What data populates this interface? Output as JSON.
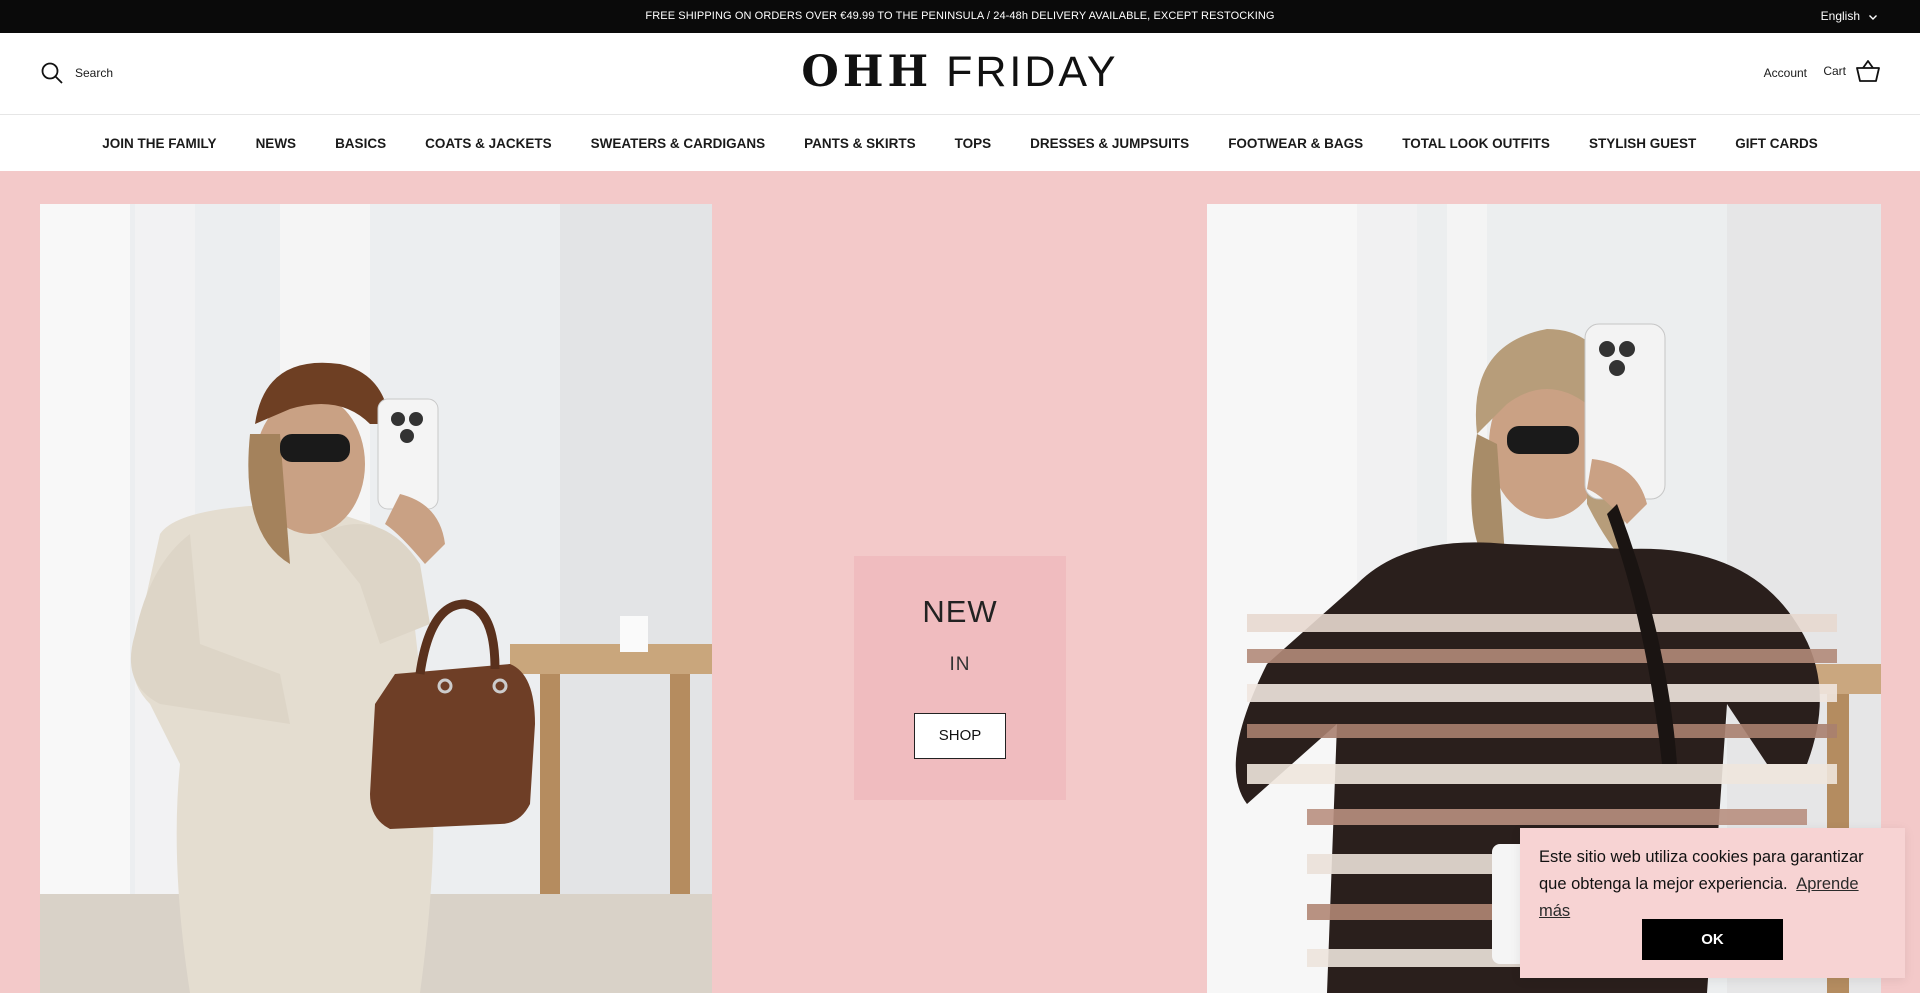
{
  "announcement": {
    "message": "FREE SHIPPING ON ORDERS OVER €49.99 TO THE PENINSULA / 24-48h DELIVERY AVAILABLE, EXCEPT RESTOCKING",
    "language": "English"
  },
  "header": {
    "search_label": "Search",
    "logo_part1": "OHH",
    "logo_part2": "FRIDAY",
    "account_label": "Account",
    "cart_label": "Cart"
  },
  "nav": {
    "items": [
      {
        "label": "JOIN THE FAMILY"
      },
      {
        "label": "NEWS"
      },
      {
        "label": "BASICS"
      },
      {
        "label": "COATS & JACKETS"
      },
      {
        "label": "SWEATERS & CARDIGANS"
      },
      {
        "label": "PANTS & SKIRTS"
      },
      {
        "label": "TOPS"
      },
      {
        "label": "DRESSES & JUMPSUITS"
      },
      {
        "label": "FOOTWEAR & BAGS"
      },
      {
        "label": "TOTAL LOOK OUTFITS"
      },
      {
        "label": "STYLISH GUEST"
      },
      {
        "label": "GIFT CARDS"
      }
    ]
  },
  "promo": {
    "heading": "NEW",
    "subheading": "IN",
    "button_label": "SHOP"
  },
  "cookie": {
    "message": "Este sitio web utiliza cookies para garantizar que obtenga la mejor experiencia.",
    "link_label": "Aprende más",
    "ok_label": "OK"
  },
  "colors": {
    "background": "#f3c9c9",
    "announcement_bg": "#0a0a0a",
    "promo_box": "#f0bcbf",
    "cookie_bg": "#f7d3d3"
  },
  "icons": [
    "search-icon",
    "chevron-down-icon",
    "cart-icon"
  ]
}
